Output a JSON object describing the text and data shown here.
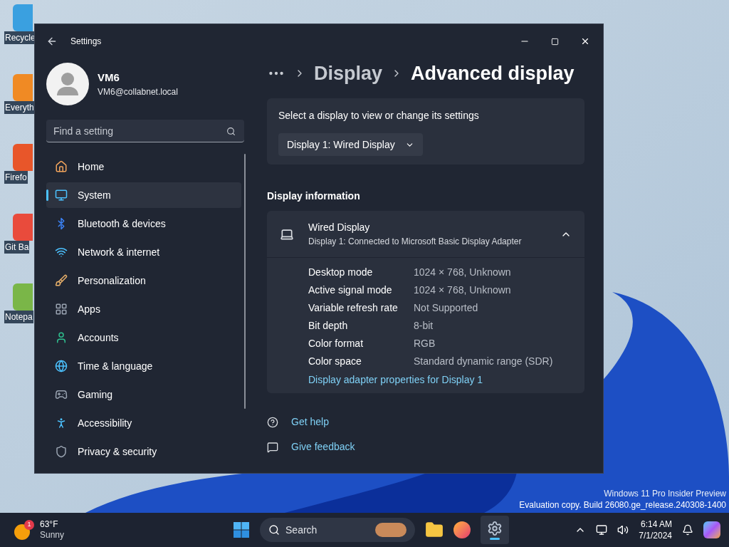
{
  "desktop_icons": [
    {
      "label": "Recycle"
    },
    {
      "label": "Everyth"
    },
    {
      "label": "Firefo"
    },
    {
      "label": "Git Ba"
    },
    {
      "label": "Notepa"
    }
  ],
  "window": {
    "title": "Settings"
  },
  "user": {
    "name": "VM6",
    "email": "VM6@collabnet.local"
  },
  "search": {
    "placeholder": "Find a setting"
  },
  "nav": [
    {
      "label": "Home",
      "kind": "home",
      "selected": false
    },
    {
      "label": "System",
      "kind": "system",
      "selected": true
    },
    {
      "label": "Bluetooth & devices",
      "kind": "bluetooth",
      "selected": false
    },
    {
      "label": "Network & internet",
      "kind": "network",
      "selected": false
    },
    {
      "label": "Personalization",
      "kind": "brush",
      "selected": false
    },
    {
      "label": "Apps",
      "kind": "apps",
      "selected": false
    },
    {
      "label": "Accounts",
      "kind": "accounts",
      "selected": false
    },
    {
      "label": "Time & language",
      "kind": "time",
      "selected": false
    },
    {
      "label": "Gaming",
      "kind": "gaming",
      "selected": false
    },
    {
      "label": "Accessibility",
      "kind": "accessibility",
      "selected": false
    },
    {
      "label": "Privacy & security",
      "kind": "privacy",
      "selected": false
    }
  ],
  "breadcrumb": [
    "Display",
    "Advanced display"
  ],
  "select_display": {
    "label": "Select a display to view or change its settings",
    "value": "Display 1: Wired Display"
  },
  "section_title": "Display information",
  "display_info": {
    "name": "Wired Display",
    "subtitle": "Display 1: Connected to Microsoft Basic Display Adapter",
    "expanded": true,
    "rows": [
      {
        "label": "Desktop mode",
        "value": "1024 × 768, Unknown"
      },
      {
        "label": "Active signal mode",
        "value": "1024 × 768, Unknown"
      },
      {
        "label": "Variable refresh rate",
        "value": "Not Supported"
      },
      {
        "label": "Bit depth",
        "value": "8-bit"
      },
      {
        "label": "Color format",
        "value": "RGB"
      },
      {
        "label": "Color space",
        "value": "Standard dynamic range (SDR)"
      }
    ],
    "link": "Display adapter properties for Display 1"
  },
  "help_links": [
    {
      "label": "Get help",
      "kind": "help"
    },
    {
      "label": "Give feedback",
      "kind": "feedback"
    }
  ],
  "watermark": [
    "Windows 11 Pro Insider Preview",
    "Evaluation copy. Build 26080.ge_release.240308-1400"
  ],
  "taskbar": {
    "weather": {
      "badge": "1",
      "temp": "63°F",
      "condition": "Sunny"
    },
    "search_placeholder": "Search",
    "time": "6:14 AM",
    "date": "7/1/2024"
  }
}
